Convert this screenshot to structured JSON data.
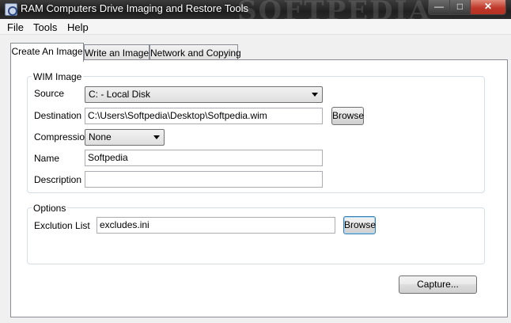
{
  "window": {
    "title": "RAM Computers Drive Imaging and Restore Tools",
    "watermark": "SOFTPEDIA"
  },
  "menu": [
    "File",
    "Tools",
    "Help"
  ],
  "tabs": [
    {
      "label": "Create An Image",
      "active": true
    },
    {
      "label": "Write an Image",
      "active": false
    },
    {
      "label": "Network and Copying",
      "active": false
    }
  ],
  "wim_image": {
    "title": "WIM Image",
    "source": {
      "label": "Source",
      "value": "C: - Local Disk"
    },
    "destination": {
      "label": "Destination",
      "value": "C:\\Users\\Softpedia\\Desktop\\Softpedia.wim",
      "browse": "Browse"
    },
    "compression": {
      "label": "Compression",
      "value": "None"
    },
    "name": {
      "label": "Name",
      "value": "Softpedia"
    },
    "description": {
      "label": "Description",
      "value": ""
    }
  },
  "options": {
    "title": "Options",
    "exclusion_list": {
      "label": "Exclution List",
      "value": "excludes.ini",
      "browse": "Browse"
    }
  },
  "capture_button": "Capture..."
}
